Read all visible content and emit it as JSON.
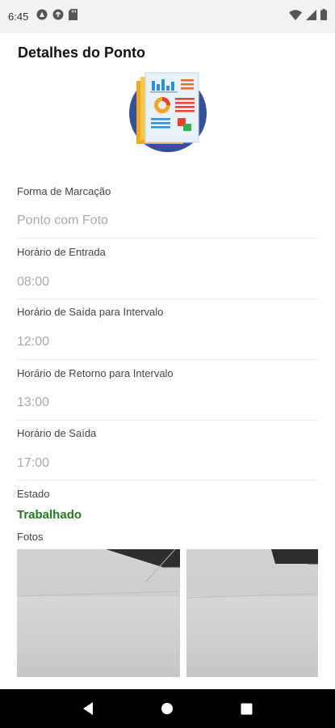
{
  "status_bar": {
    "time": "6:45",
    "left_icons": [
      "vpn-icon",
      "sync-icon",
      "sd-card-icon"
    ],
    "right_icons": [
      "wifi-icon",
      "signal-icon",
      "battery-icon"
    ]
  },
  "page": {
    "title": "Detalhes do Ponto",
    "illustration": "report-document-icon"
  },
  "fields": [
    {
      "label": "Forma de Marcação",
      "value": "Ponto com Foto"
    },
    {
      "label": "Horário de Entrada",
      "value": "08:00"
    },
    {
      "label": "Horário de Saída para Intervalo",
      "value": "12:00"
    },
    {
      "label": "Horário de Retorno para Intervalo",
      "value": "13:00"
    },
    {
      "label": "Horário de Saída",
      "value": "17:00"
    }
  ],
  "status": {
    "label": "Estado",
    "value": "Trabalhado",
    "color": "#207a1e"
  },
  "photos": {
    "label": "Fotos",
    "count_visible": 2
  },
  "nav_bar": {
    "buttons": [
      "back-icon",
      "home-icon",
      "recents-icon"
    ]
  }
}
